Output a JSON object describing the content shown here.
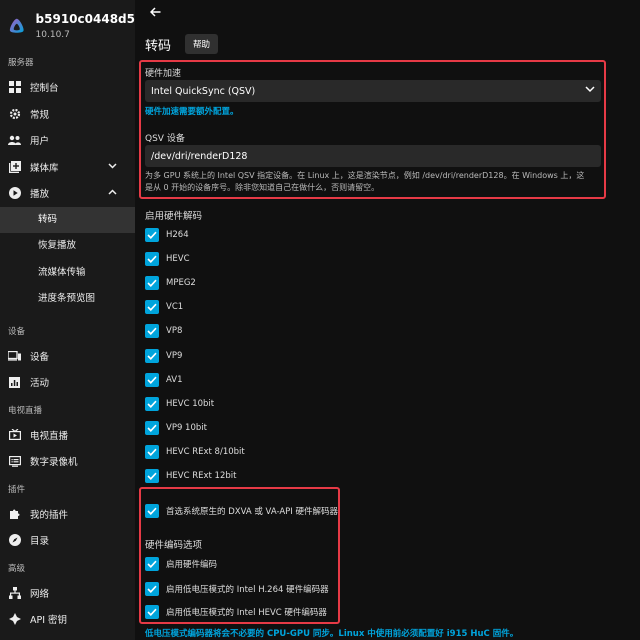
{
  "app": {
    "server_name": "b5910c0448d5",
    "version": "10.10.7"
  },
  "sidebar": {
    "sections": [
      {
        "title": "服务器"
      },
      {
        "title": "设备"
      },
      {
        "title": "电视直播"
      },
      {
        "title": "插件"
      },
      {
        "title": "高级"
      }
    ],
    "items": {
      "dashboard": "控制台",
      "general": "常规",
      "users": "用户",
      "libraries": "媒体库",
      "playback": "播放",
      "transcoding": "转码",
      "resume": "恢复播放",
      "streaming": "流媒体传输",
      "trickplay": "进度条预览图",
      "devices": "设备",
      "activity": "活动",
      "livetv": "电视直播",
      "dvr": "数字录像机",
      "myplugins": "我的插件",
      "catalog": "目录",
      "networking": "网络",
      "apikeys": "API 密钥"
    }
  },
  "page": {
    "title": "转码",
    "help_label": "帮助"
  },
  "hw_accel": {
    "label": "硬件加速",
    "value": "Intel QuickSync (QSV)",
    "link": "硬件加速需要额外配置。"
  },
  "qsv_device": {
    "label": "QSV 设备",
    "value": "/dev/dri/renderD128",
    "help_line1": "为多 GPU 系统上的 Intel QSV 指定设备。在 Linux 上，这是渲染节点，例如 /dev/dri/renderD128。在 Windows 上，这",
    "help_line2": "是从 0 开始的设备序号。除非您知道自己在做什么，否则请留空。"
  },
  "hw_decode": {
    "title": "启用硬件解码",
    "codecs": [
      "H264",
      "HEVC",
      "MPEG2",
      "VC1",
      "VP8",
      "VP9",
      "AV1",
      "HEVC 10bit",
      "VP9 10bit",
      "HEVC RExt 8/10bit",
      "HEVC RExt 12bit"
    ]
  },
  "prefer_native": "首选系统原生的 DXVA 或 VA-API 硬件解码器",
  "hw_encode": {
    "title": "硬件编码选项",
    "enable": "启用硬件编码",
    "lowpower_h264": "启用低电压模式的 Intel H.264 硬件编码器",
    "lowpower_hevc": "启用低电压模式的 Intel HEVC 硬件编码器"
  },
  "bottom_note": "低电压模式编码器将会不必要的 CPU-GPU 同步。Linux 中使用前必须配置好 i915 HuC 固件。",
  "colors": {
    "accent": "#00a4dc",
    "highlight_box": "#e63a46",
    "background": "#101010",
    "sidebar": "#1a1a1a"
  }
}
